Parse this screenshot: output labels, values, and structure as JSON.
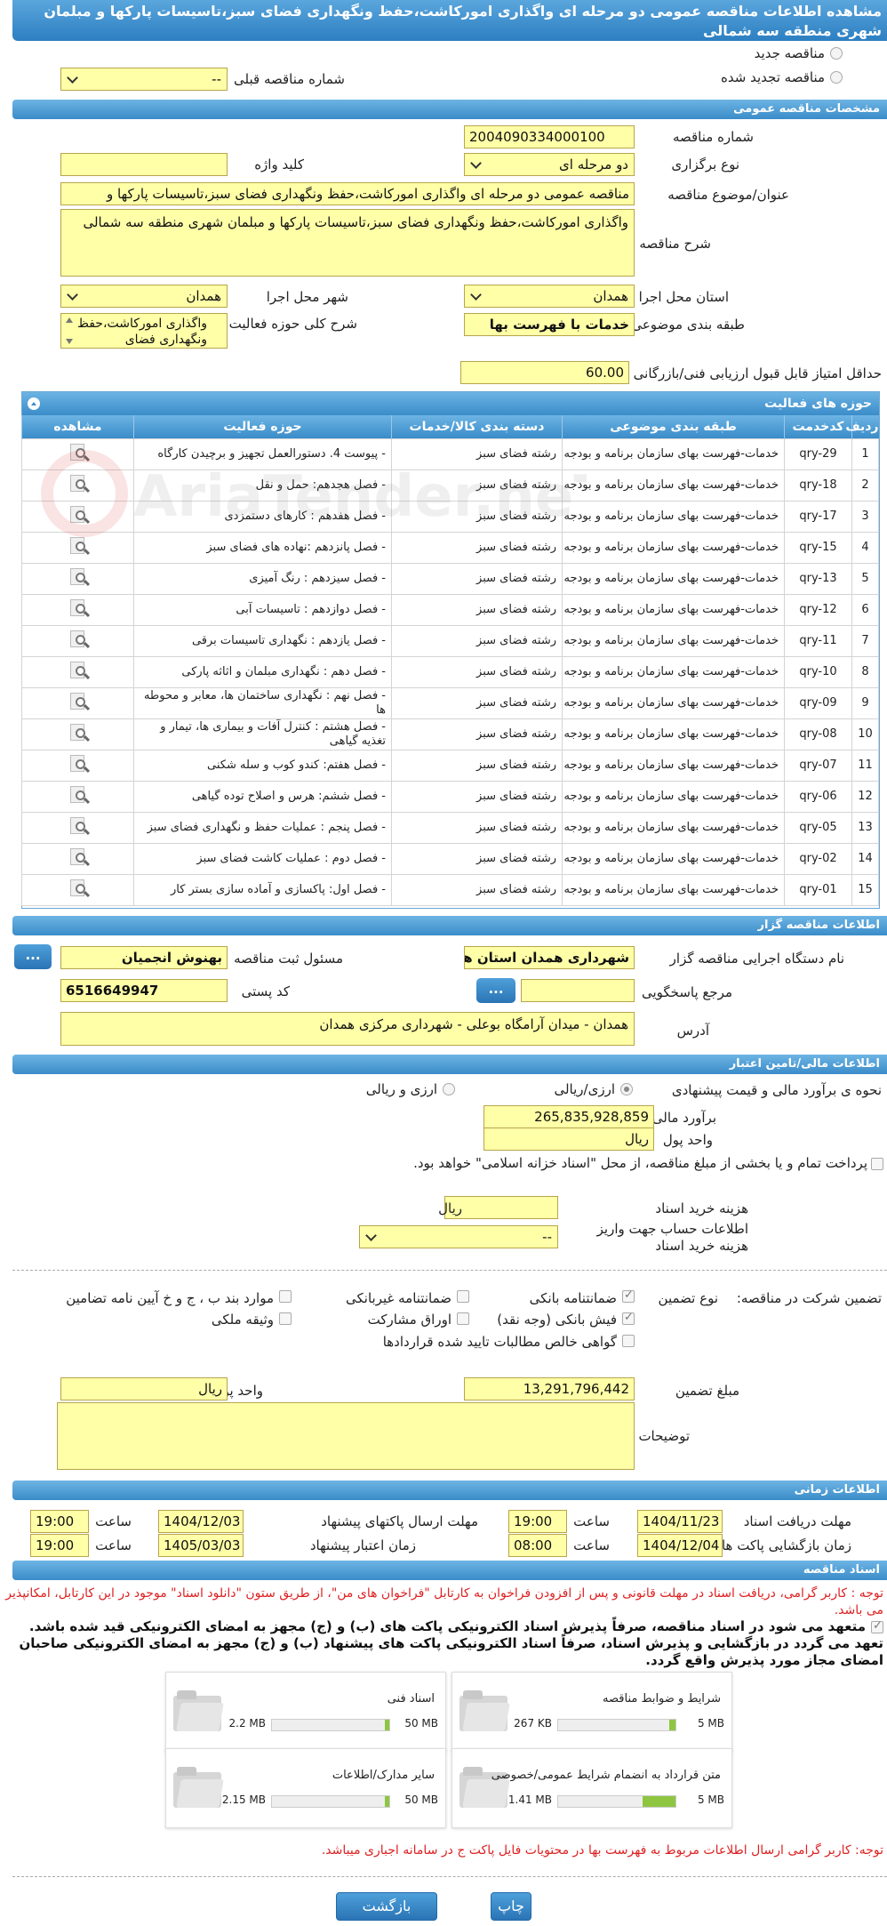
{
  "title": "مشاهده اطلاعات مناقصه عمومی دو مرحله ای واگذاری امورکاشت،حفظ ونگهداری فضای سبز،تاسیسات پارکها و مبلمان شهری منطقه سه شمالی",
  "top": {
    "new_tender": "مناقصه جدید",
    "renewed_tender": "مناقصه تجدید شده",
    "prev_number_label": "شماره مناقصه قبلی",
    "prev_number_value": "--"
  },
  "general": {
    "header": "مشخصات مناقصه عمومی",
    "number_label": "شماره مناقصه",
    "number_value": "2004090334000100",
    "type_label": "نوع برگزاری",
    "type_value": "دو مرحله ای",
    "keyword_label": "کلید واژه",
    "keyword_value": "",
    "subject_label": "عنوان/موضوع مناقصه",
    "subject_value": "مناقصه عمومی دو مرحله ای واگذاری امورکاشت،حفظ ونگهداری فضای سبز،تاسیسات پارکها و",
    "desc_label": "شرح مناقصه",
    "desc_value": "واگذاری امورکاشت،حفظ ونگهداری فضای سبز،تاسیسات پارکها و مبلمان شهری منطقه سه شمالی",
    "province_label": "استان محل اجرا",
    "province_value": "همدان",
    "city_label": "شهر محل اجرا",
    "city_value": "همدان",
    "category_label": "طبقه بندی موضوعی",
    "category_value": "خدمات با فهرست بها",
    "activity_label": "شرح کلی حوزه فعالیت",
    "activity_value": "واگذاری امورکاشت،حفظ ونگهداری فضای",
    "min_score_label": "حداقل امتیاز قابل قبول ارزیابی فنی/بازرگانی",
    "min_score_value": "60.00"
  },
  "activities": {
    "header": "حوزه های فعالیت",
    "columns": [
      "ردیف",
      "کدخدمت",
      "طبقه بندی موضوعی",
      "دسته بندی کالا/خدمات",
      "حوزه فعالیت",
      "مشاهده"
    ],
    "rows": [
      {
        "n": "1",
        "code": "qry-29",
        "cat": "خدمات-فهرست بهای سازمان برنامه و بودجه",
        "group": "رشته فضای سبز",
        "area": "- پیوست 4. دستورالعمل تجهیز و برچیدن کارگاه"
      },
      {
        "n": "2",
        "code": "qry-18",
        "cat": "خدمات-فهرست بهای سازمان برنامه و بودجه",
        "group": "رشته فضای سبز",
        "area": "- فصل هجدهم: حمل و نقل"
      },
      {
        "n": "3",
        "code": "qry-17",
        "cat": "خدمات-فهرست بهای سازمان برنامه و بودجه",
        "group": "رشته فضای سبز",
        "area": "- فصل هفدهم : کارهای دستمزدی"
      },
      {
        "n": "4",
        "code": "qry-15",
        "cat": "خدمات-فهرست بهای سازمان برنامه و بودجه",
        "group": "رشته فضای سبز",
        "area": "- فصل پانزدهم :نهاده های فضای سبز"
      },
      {
        "n": "5",
        "code": "qry-13",
        "cat": "خدمات-فهرست بهای سازمان برنامه و بودجه",
        "group": "رشته فضای سبز",
        "area": "- فصل سیزدهم : رنگ آمیزی"
      },
      {
        "n": "6",
        "code": "qry-12",
        "cat": "خدمات-فهرست بهای سازمان برنامه و بودجه",
        "group": "رشته فضای سبز",
        "area": "- فصل دوازدهم : تاسیسات آبی"
      },
      {
        "n": "7",
        "code": "qry-11",
        "cat": "خدمات-فهرست بهای سازمان برنامه و بودجه",
        "group": "رشته فضای سبز",
        "area": "- فصل یازدهم : نگهداری تاسیسات برقی"
      },
      {
        "n": "8",
        "code": "qry-10",
        "cat": "خدمات-فهرست بهای سازمان برنامه و بودجه",
        "group": "رشته فضای سبز",
        "area": "- فصل دهم : نگهداری مبلمان و اثاثه پارکی"
      },
      {
        "n": "9",
        "code": "qry-09",
        "cat": "خدمات-فهرست بهای سازمان برنامه و بودجه",
        "group": "رشته فضای سبز",
        "area": "- فصل نهم : نگهداری ساختمان ها، معابر و محوطه ها"
      },
      {
        "n": "10",
        "code": "qry-08",
        "cat": "خدمات-فهرست بهای سازمان برنامه و بودجه",
        "group": "رشته فضای سبز",
        "area": "- فصل هشتم : کنترل آفات و بیماری ها، تیمار و تغذیه گیاهی"
      },
      {
        "n": "11",
        "code": "qry-07",
        "cat": "خدمات-فهرست بهای سازمان برنامه و بودجه",
        "group": "رشته فضای سبز",
        "area": "- فصل هفتم: کندو کوب و سله شکنی"
      },
      {
        "n": "12",
        "code": "qry-06",
        "cat": "خدمات-فهرست بهای سازمان برنامه و بودجه",
        "group": "رشته فضای سبز",
        "area": "- فصل ششم: هرس و اصلاح توده گیاهی"
      },
      {
        "n": "13",
        "code": "qry-05",
        "cat": "خدمات-فهرست بهای سازمان برنامه و بودجه",
        "group": "رشته فضای سبز",
        "area": "- فصل پنجم : عملیات حفظ و نگهداری فضای سبز"
      },
      {
        "n": "14",
        "code": "qry-02",
        "cat": "خدمات-فهرست بهای سازمان برنامه و بودجه",
        "group": "رشته فضای سبز",
        "area": "- فصل دوم : عملیات کاشت فضای سبز"
      },
      {
        "n": "15",
        "code": "qry-01",
        "cat": "خدمات-فهرست بهای سازمان برنامه و بودجه",
        "group": "رشته فضای سبز",
        "area": "- فصل اول:  پاکسازی و آماده سازی بستر کار"
      }
    ]
  },
  "organizer": {
    "header": "اطلاعات مناقصه گزار",
    "org_label": "نام دستگاه اجرایی مناقصه گزار",
    "org_value": "شهرداری همدان استان هم",
    "officer_label": "مسئول ثبت مناقصه",
    "officer_value": "بهنوش انجمیان",
    "ref_label": "مرجع پاسخگویی",
    "ref_value": "",
    "postal_label": "کد پستی",
    "postal_value": "6516649947",
    "address_label": "آدرس",
    "address_value": "همدان - میدان آرامگاه بوعلی - شهرداری مرکزی همدان",
    "dots": "..."
  },
  "finance": {
    "header": "اطلاعات مالی/تامین اعتبار",
    "estimate_method_label": "نحوه ی برآورد مالی و قیمت پیشنهادی",
    "opt_rial": "ارزی/ریالی",
    "opt_both": "ارزی و ریالی",
    "estimate_label": "برآورد مالی",
    "estimate_value": "265,835,928,859",
    "currency_label": "واحد پول",
    "currency_value": "ریال",
    "treasury_text": "پرداخت تمام و یا بخشی از مبلغ مناقصه، از محل \"اسناد خزانه اسلامی\" خواهد بود.",
    "doc_cost_label": "هزینه خرید اسناد",
    "doc_cost_unit": "ریال",
    "doc_cost_value": "",
    "account_label": "اطلاعات حساب جهت واریز هزینه خرید اسناد",
    "account_value": "--"
  },
  "guarantee": {
    "participation_label": "تضمین شرکت در مناقصه:",
    "type_label": "نوع تضمین",
    "bank_guarantee": "ضمانتنامه بانکی",
    "non_bank_guarantee": "ضمانتنامه غیربانکی",
    "article_items": "موارد بند ب ، ج و خ آیین نامه تضامین",
    "bank_receipt": "فیش بانکی (وجه نقد)",
    "bonds": "اوراق مشارکت",
    "property_bail": "وثیقه ملکی",
    "net_claims": "گواهی خالص مطالبات تایید شده قراردادها",
    "amount_label": "مبلغ تضمین",
    "amount_value": "13,291,796,442",
    "currency_label": "واحد پول",
    "currency_value": "ریال",
    "notes_label": "توضیحات",
    "notes_value": ""
  },
  "timing": {
    "header": "اطلاعات زمانی",
    "receive_deadline_label": "مهلت دریافت اسناد",
    "receive_deadline_date": "1404/11/23",
    "receive_deadline_time": "19:00",
    "send_deadline_label": "مهلت ارسال پاکتهای پیشنهاد",
    "send_deadline_date": "1404/12/03",
    "send_deadline_time": "19:00",
    "opening_label": "زمان بازگشایی پاکت ها",
    "opening_date": "1404/12/04",
    "opening_time": "08:00",
    "validity_label": "زمان اعتبار پیشنهاد",
    "validity_date": "1405/03/03",
    "validity_time": "19:00",
    "time_label": "ساعت"
  },
  "docs": {
    "header": "اسناد مناقصه",
    "notice": "توجه : کاربر گرامی، دریافت اسناد در مهلت قانونی و پس از افزودن فراخوان به کارتابل \"فراخوان های من\"، از طریق ستون \"دانلود اسناد\" موجود در این کارتابل، امکانپذیر می باشد.",
    "commit": "متعهد می شود در اسناد مناقصه، صرفاً پذیرش اسناد الکترونیکی پاکت های (ب) و (ج) مجهز به امضای الکترونیکی قید شده باشد. تعهد می گردد در بازگشایی و پذیرش اسناد، صرفاً اسناد الکترونیکی پاکت های پیشنهاد (ب) و (ج) مجهز به امضای الکترونیکی صاحبان امضای مجاز مورد پذیرش واقع گردد.",
    "files": [
      {
        "title": "شرایط و ضوابط مناقصه",
        "size": "267 KB",
        "max": "5 MB",
        "fill": 0.05
      },
      {
        "title": "اسناد فنی",
        "size": "2.2 MB",
        "max": "50 MB",
        "fill": 0.04
      },
      {
        "title": "متن قرارداد به انضمام شرایط عمومی/خصوصی",
        "size": "1.41 MB",
        "max": "5 MB",
        "fill": 0.28
      },
      {
        "title": "سایر مدارک/اطلاعات",
        "size": "2.15 MB",
        "max": "50 MB",
        "fill": 0.04
      }
    ],
    "footer_note": "توجه: کاربر گرامی ارسال اطلاعات مربوط به فهرست بها در محتویات فایل پاکت ج در سامانه اجباری میباشد."
  },
  "buttons": {
    "back": "بازگشت",
    "print": "چاپ"
  },
  "watermark": "AriaTender.neT"
}
